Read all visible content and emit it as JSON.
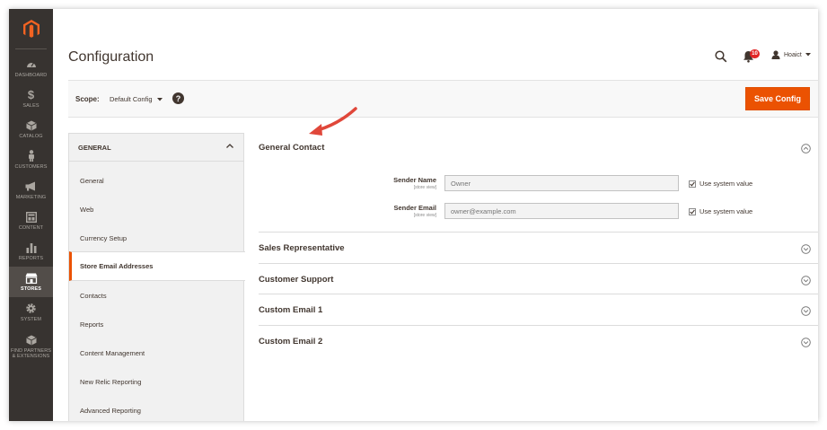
{
  "sidebar": {
    "items": [
      {
        "label": "DASHBOARD",
        "icon": "dashboard-icon"
      },
      {
        "label": "SALES",
        "icon": "dollar-icon"
      },
      {
        "label": "CATALOG",
        "icon": "cube-icon"
      },
      {
        "label": "CUSTOMERS",
        "icon": "person-icon"
      },
      {
        "label": "MARKETING",
        "icon": "megaphone-icon"
      },
      {
        "label": "CONTENT",
        "icon": "layout-icon"
      },
      {
        "label": "REPORTS",
        "icon": "bar-chart-icon"
      },
      {
        "label": "STORES",
        "icon": "store-icon"
      },
      {
        "label": "SYSTEM",
        "icon": "gear-icon"
      },
      {
        "label": "FIND PARTNERS & EXTENSIONS",
        "icon": "box-icon"
      }
    ],
    "active": "STORES"
  },
  "header": {
    "title": "Configuration",
    "notifications_count": "10",
    "user_name": "Hoaict"
  },
  "scope": {
    "label": "Scope:",
    "value": "Default Config",
    "help": "?"
  },
  "toolbar": {
    "save_label": "Save Config"
  },
  "tabs": {
    "group_title": "GENERAL",
    "items": [
      "General",
      "Web",
      "Currency Setup",
      "Store Email Addresses",
      "Contacts",
      "Reports",
      "Content Management",
      "New Relic Reporting",
      "Advanced Reporting"
    ],
    "active": "Store Email Addresses"
  },
  "sections": [
    {
      "title": "General Contact",
      "expanded": true
    },
    {
      "title": "Sales Representative",
      "expanded": false
    },
    {
      "title": "Customer Support",
      "expanded": false
    },
    {
      "title": "Custom Email 1",
      "expanded": false
    },
    {
      "title": "Custom Email 2",
      "expanded": false
    }
  ],
  "fields": {
    "sender_name": {
      "label": "Sender Name",
      "scope": "[store view]",
      "placeholder": "Owner",
      "use_system_label": "Use system value",
      "use_system_checked": true
    },
    "sender_email": {
      "label": "Sender Email",
      "scope": "[store view]",
      "placeholder": "owner@example.com",
      "use_system_label": "Use system value",
      "use_system_checked": true
    }
  },
  "colors": {
    "accent": "#eb5202",
    "sidebar_bg": "#373330",
    "text": "#41362f",
    "badge": "#e22626",
    "annotation_arrow": "#e0473a"
  }
}
